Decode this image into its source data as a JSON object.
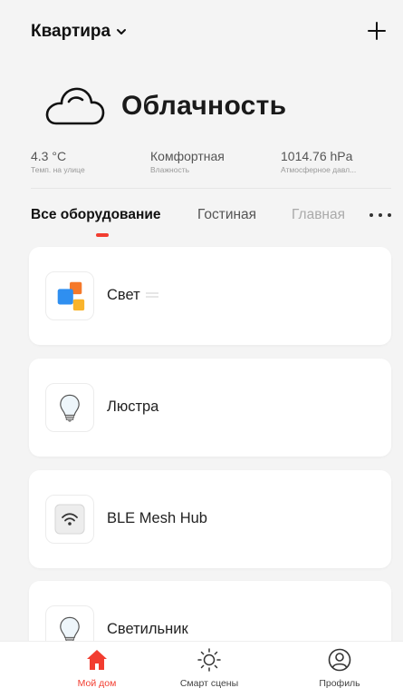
{
  "header": {
    "home_name": "Квартира"
  },
  "weather": {
    "condition": "Облачность",
    "stats": [
      {
        "value": "4.3 °C",
        "label": "Темп. на улице"
      },
      {
        "value": "Комфортная",
        "label": "Влажность"
      },
      {
        "value": "1014.76 hPa",
        "label": "Атмосферное давл..."
      }
    ]
  },
  "tabs": [
    {
      "label": "Все оборудование",
      "active": true
    },
    {
      "label": "Гостиная",
      "active": false
    },
    {
      "label": "Главная",
      "active": false
    }
  ],
  "devices": [
    {
      "name": "Свет",
      "icon": "light-group-icon"
    },
    {
      "name": "Люстра",
      "icon": "bulb-icon"
    },
    {
      "name": "BLE Mesh Hub",
      "icon": "wifi-hub-icon"
    },
    {
      "name": "Светильник",
      "icon": "bulb-icon"
    }
  ],
  "nav": [
    {
      "label": "Мой дом",
      "icon": "home-icon",
      "active": true
    },
    {
      "label": "Смарт сцены",
      "icon": "sun-icon",
      "active": false
    },
    {
      "label": "Профиль",
      "icon": "profile-icon",
      "active": false
    }
  ],
  "colors": {
    "accent": "#f23d30",
    "background": "#f4f4f4",
    "card": "#ffffff"
  }
}
